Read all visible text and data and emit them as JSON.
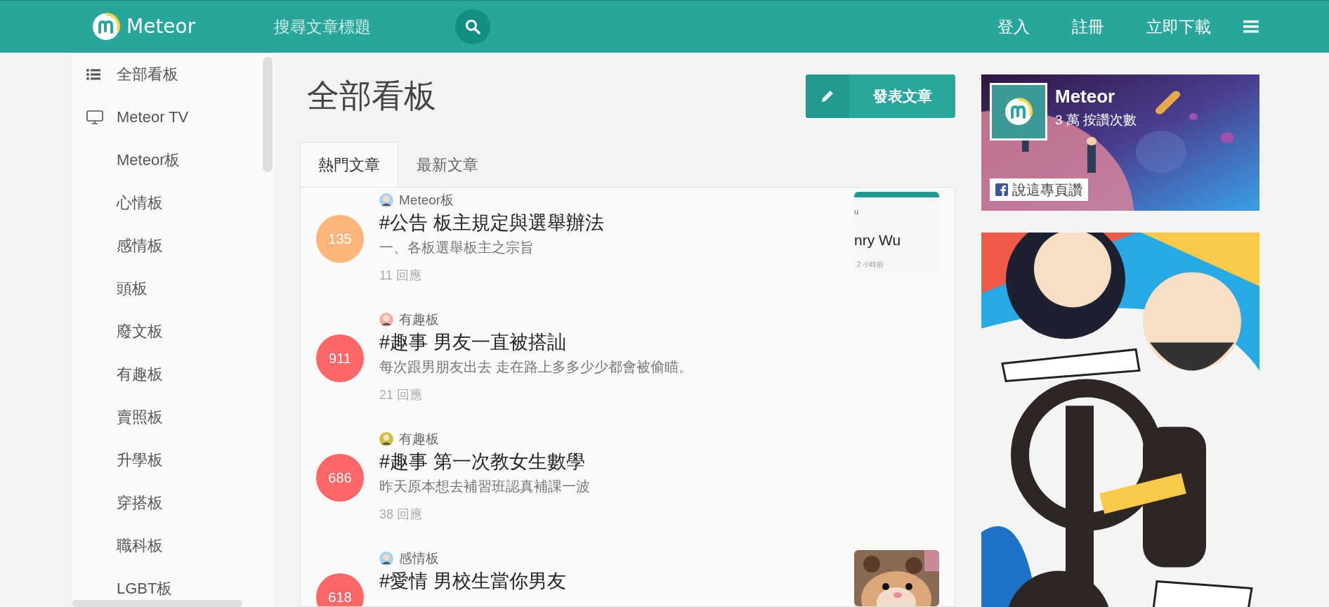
{
  "header": {
    "brand": "Meteor",
    "search": {
      "placeholder": "搜尋文章標題"
    },
    "nav": [
      "登入",
      "註冊",
      "立即下載"
    ]
  },
  "sidebar": {
    "items": [
      {
        "label": "全部看板",
        "kind": "list"
      },
      {
        "label": "Meteor TV",
        "kind": "tv"
      },
      {
        "label": "Meteor板",
        "kind": "plain"
      },
      {
        "label": "心情板",
        "kind": "plain"
      },
      {
        "label": "感情板",
        "kind": "plain"
      },
      {
        "label": "頭板",
        "kind": "plain"
      },
      {
        "label": "廢文板",
        "kind": "plain"
      },
      {
        "label": "有趣板",
        "kind": "plain"
      },
      {
        "label": "賣照板",
        "kind": "plain"
      },
      {
        "label": "升學板",
        "kind": "plain"
      },
      {
        "label": "穿搭板",
        "kind": "plain"
      },
      {
        "label": "職科板",
        "kind": "plain"
      },
      {
        "label": "LGBT板",
        "kind": "plain"
      }
    ]
  },
  "main": {
    "title": "全部看板",
    "post_button": "發表文章",
    "tabs": [
      {
        "label": "熱門文章",
        "selected": true
      },
      {
        "label": "最新文章",
        "selected": false
      }
    ],
    "posts": [
      {
        "score": "135",
        "color": "#fdb57a",
        "board": "Meteor板",
        "title": "#公告 板主規定與選舉辦法",
        "excerpt": "一、各板選舉板主之宗旨",
        "replies": "11 回應",
        "thumbnail": {
          "kind": "card",
          "lines": [
            "u",
            "nry Wu",
            "2 小時前"
          ]
        }
      },
      {
        "score": "911",
        "color": "#ff6666",
        "board": "有趣板",
        "title": "#趣事 男友一直被搭訕",
        "excerpt": "每次跟男朋友出去 走在路上多多少少都會被偷瞄。",
        "replies": "21 回應"
      },
      {
        "score": "686",
        "color": "#ff6666",
        "board": "有趣板",
        "title": "#趣事 第一次教女生數學",
        "excerpt": "昨天原本想去補習班認真補課一波",
        "replies": "38 回應"
      },
      {
        "score": "618",
        "color": "#ff6666",
        "board": "感情板",
        "title": "#愛情 男校生當你男友"
      }
    ]
  },
  "fb_widget": {
    "name": "Meteor",
    "likes": "3 萬 按讚次數",
    "like_button": "說這專頁讚"
  }
}
